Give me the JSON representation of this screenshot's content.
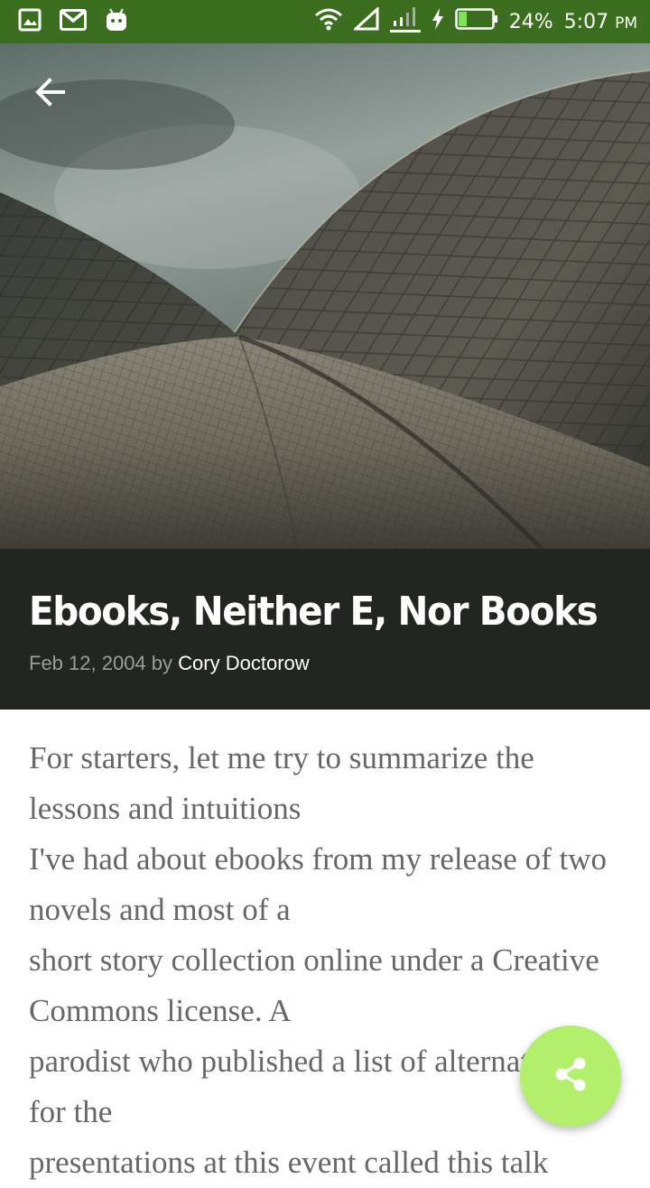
{
  "status_bar": {
    "battery_percent_label": "24%",
    "time": "5:07",
    "time_suffix": "PM",
    "icons": [
      "gallery-icon",
      "gmail-icon",
      "android-icon",
      "wifi-icon",
      "signal-icon",
      "mobile-data-icon",
      "charging-icon",
      "battery-icon"
    ],
    "battery_level": 0.24,
    "color": "#3b6f1f"
  },
  "header": {
    "back_icon": "arrow-left-icon",
    "hero_image": "opera-house-shells-photo"
  },
  "post": {
    "title": "Ebooks, Neither E, Nor Books",
    "date": "Feb 12, 2004",
    "by": "by",
    "author": "Cory Doctorow",
    "band_color": "#222621"
  },
  "article": {
    "lines": [
      "For starters, let me try to summarize the lessons and intuitions",
      "I've had about ebooks from my release of two novels and most of a",
      "short story collection online under a Creative Commons license. A",
      "parodist who published a list of alternate titles for the",
      "presentations at this event called this talk"
    ]
  },
  "fab": {
    "icon": "share-icon",
    "color": "#b2ef6b"
  }
}
